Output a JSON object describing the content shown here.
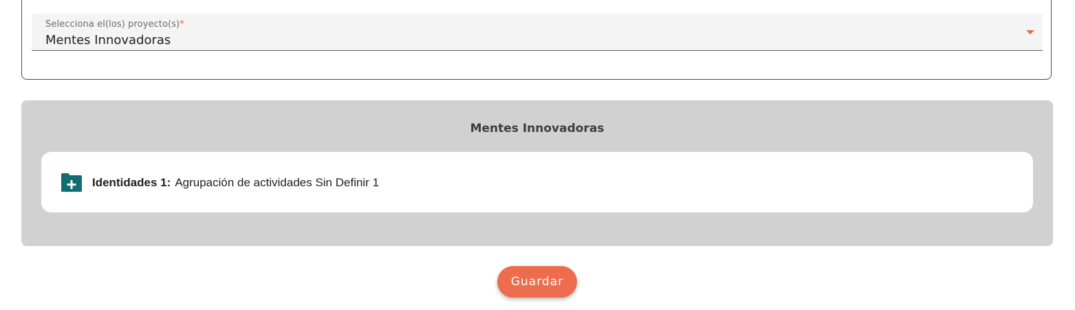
{
  "project_selector": {
    "label": "Selecciona el(los) proyecto(s)",
    "required_mark": "*",
    "value": "Mentes Innovadoras",
    "arrow_icon": "triangle-down-icon",
    "accent_color": "#e8674a"
  },
  "project_panel": {
    "title": "Mentes Innovadoras",
    "background_color": "#d1d1d1",
    "identities": [
      {
        "icon": "folder-plus-icon",
        "icon_color": "#0e6e73",
        "label": "Identidades 1:",
        "value": "Agrupación de actividades Sin Definir 1"
      }
    ]
  },
  "actions": {
    "save_label": "Guardar",
    "save_color": "#ee6d4e"
  }
}
